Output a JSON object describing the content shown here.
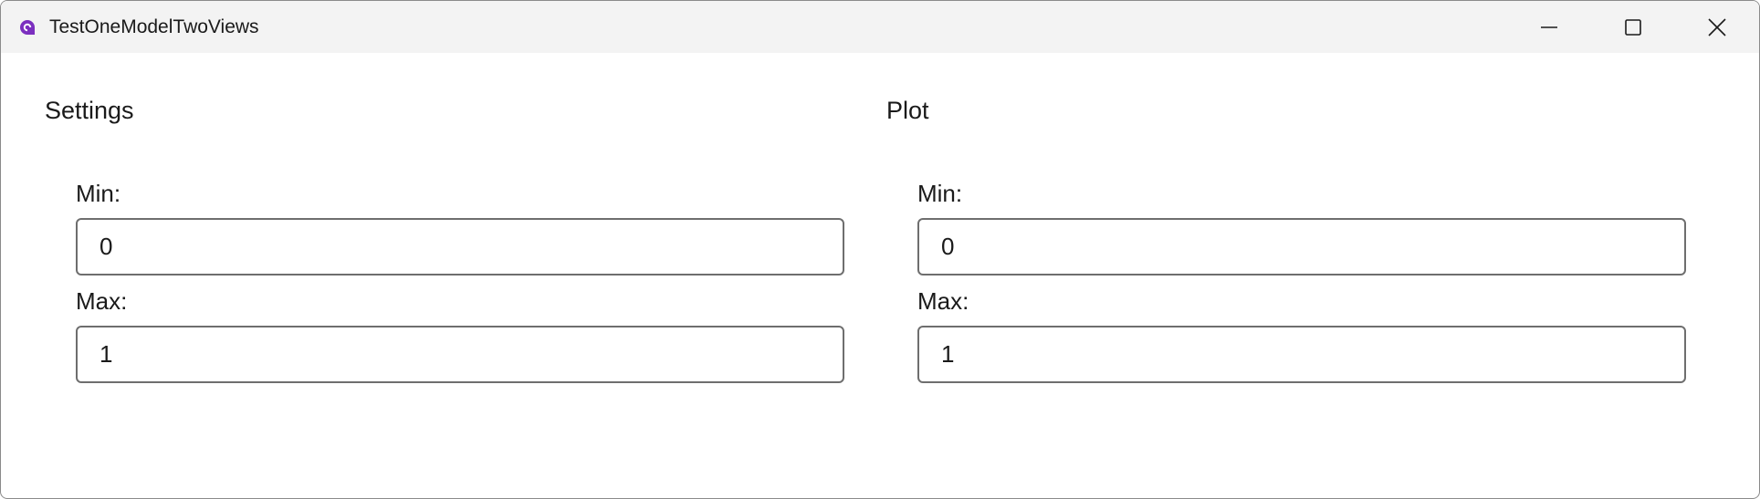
{
  "window": {
    "title": "TestOneModelTwoViews",
    "accent_color": "#7b2fbf"
  },
  "caption_buttons": {
    "minimize_icon": "minimize-icon",
    "maximize_icon": "maximize-icon",
    "close_icon": "close-icon"
  },
  "settings_panel": {
    "title": "Settings",
    "min_label": "Min:",
    "min_value": "0",
    "max_label": "Max:",
    "max_value": "1"
  },
  "plot_panel": {
    "title": "Plot",
    "min_label": "Min:",
    "min_value": "0",
    "max_label": "Max:",
    "max_value": "1"
  }
}
